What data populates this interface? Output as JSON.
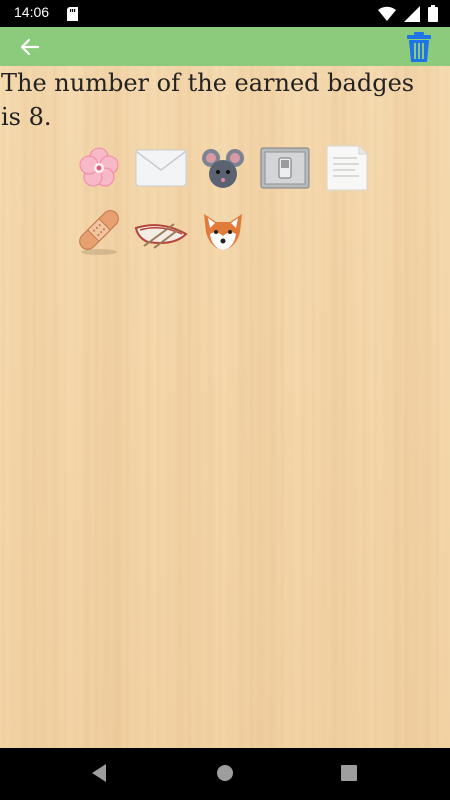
{
  "status_bar": {
    "time": "14:06",
    "icons": [
      "sd-card-icon",
      "wifi-icon",
      "signal-icon",
      "battery-icon"
    ]
  },
  "toolbar": {
    "background": "#8ccb7c",
    "back_icon": "arrow-left-icon",
    "trash_icon": "trash-icon",
    "trash_color": "#1e73e8"
  },
  "main": {
    "message": "The number of the earned badges is 8.",
    "badges": [
      {
        "name": "flower-badge",
        "icon": "cherry-blossom"
      },
      {
        "name": "envelope-badge",
        "icon": "envelope"
      },
      {
        "name": "mouse-badge",
        "icon": "mouse"
      },
      {
        "name": "switch-badge",
        "icon": "light-switch"
      },
      {
        "name": "paper-badge",
        "icon": "paper"
      },
      {
        "name": "bandage-badge",
        "icon": "bandage"
      },
      {
        "name": "boat-badge",
        "icon": "rowboat"
      },
      {
        "name": "fox-badge",
        "icon": "fox"
      }
    ]
  },
  "nav_bar": {
    "buttons": [
      "back-triangle-icon",
      "home-circle-icon",
      "recents-square-icon"
    ]
  }
}
